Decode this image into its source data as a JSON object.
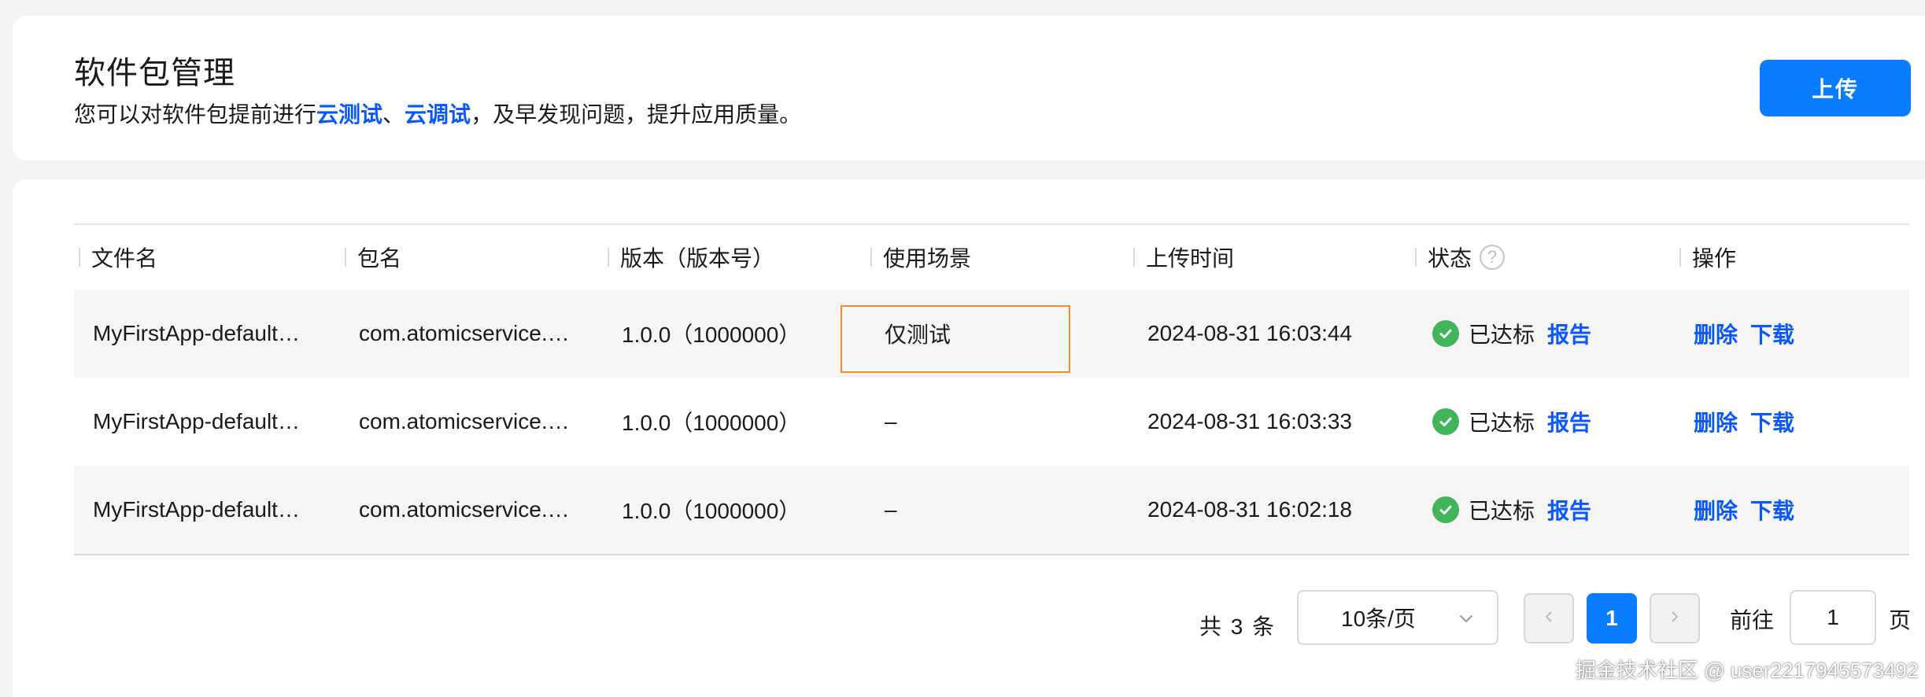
{
  "header": {
    "title": "软件包管理",
    "desc_prefix": "您可以对软件包提前进行",
    "link_cloud_test": "云测试",
    "sep": "、",
    "link_cloud_debug": "云调试",
    "desc_suffix": "，及早发现问题，提升应用质量。",
    "upload_label": "上传"
  },
  "table": {
    "columns": {
      "filename": "文件名",
      "package": "包名",
      "version": "版本（版本号）",
      "scene": "使用场景",
      "upload_time": "上传时间",
      "status": "状态",
      "actions": "操作"
    },
    "rows": [
      {
        "filename": "MyFirstApp-default…",
        "package": "com.atomicservice.…",
        "version": "1.0.0（1000000）",
        "scene": "仅测试",
        "upload_time": "2024-08-31 16:03:44",
        "status": "已达标",
        "report": "报告",
        "delete": "删除",
        "download": "下载"
      },
      {
        "filename": "MyFirstApp-default…",
        "package": "com.atomicservice.…",
        "version": "1.0.0（1000000）",
        "scene": "–",
        "upload_time": "2024-08-31 16:03:33",
        "status": "已达标",
        "report": "报告",
        "delete": "删除",
        "download": "下载"
      },
      {
        "filename": "MyFirstApp-default…",
        "package": "com.atomicservice.…",
        "version": "1.0.0（1000000）",
        "scene": "–",
        "upload_time": "2024-08-31 16:02:18",
        "status": "已达标",
        "report": "报告",
        "delete": "删除",
        "download": "下载"
      }
    ]
  },
  "pagination": {
    "total_text": "共 3 条",
    "page_size": "10条/页",
    "current_page": "1",
    "goto_label": "前往",
    "goto_value": "1",
    "page_label": "页"
  },
  "watermark": "掘金技术社区 @ user2217945573492",
  "colors": {
    "accent": "#0a7cff",
    "link": "#0a59f7",
    "success": "#41b55a",
    "highlight_border": "#f08b2a"
  },
  "icons": [
    "help-circle-icon",
    "check-circle-icon",
    "chevron-down-icon",
    "chevron-left-icon",
    "chevron-right-icon"
  ]
}
